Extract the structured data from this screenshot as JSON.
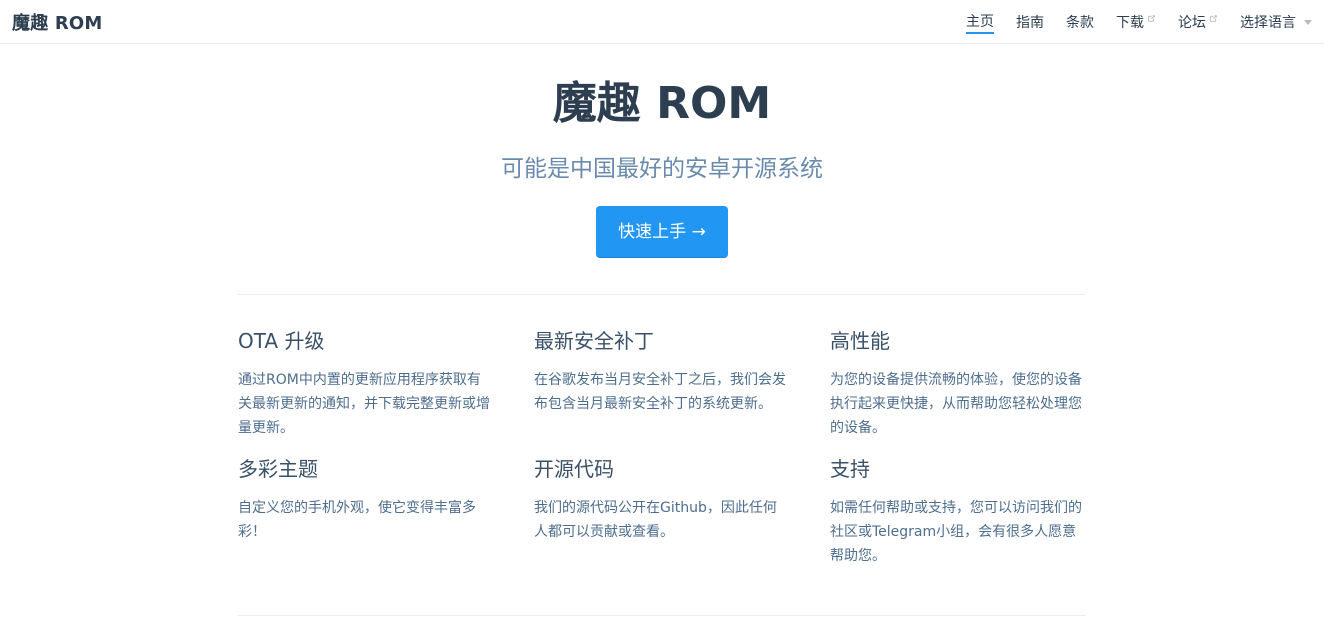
{
  "navbar": {
    "site_name": "魔趣 ROM",
    "links": [
      {
        "label": "主页",
        "active": true,
        "external": false
      },
      {
        "label": "指南",
        "active": false,
        "external": false
      },
      {
        "label": "条款",
        "active": false,
        "external": false
      },
      {
        "label": "下载",
        "active": false,
        "external": true
      },
      {
        "label": "论坛",
        "active": false,
        "external": true
      }
    ],
    "language_label": "选择语言",
    "accent_color": "#2196f3"
  },
  "hero": {
    "title": "魔趣 ROM",
    "description": "可能是中国最好的安卓开源系统",
    "action_label": "快速上手 →",
    "action_color": "#2196f3"
  },
  "features": [
    {
      "title": "OTA 升级",
      "details": "通过ROM中内置的更新应用程序获取有关最新更新的通知，并下载完整更新或增量更新。"
    },
    {
      "title": "最新安全补丁",
      "details": "在谷歌发布当月安全补丁之后，我们会发布包含当月最新安全补丁的系统更新。"
    },
    {
      "title": "高性能",
      "details": "为您的设备提供流畅的体验，使您的设备执行起来更快捷，从而帮助您轻松处理您的设备。"
    },
    {
      "title": "多彩主题",
      "details": "自定义您的手机外观，使它变得丰富多彩！"
    },
    {
      "title": "开源代码",
      "details": "我们的源代码公开在Github，因此任何人都可以贡献或查看。"
    },
    {
      "title": "支持",
      "details": "如需任何帮助或支持，您可以访问我们的社区或Telegram小组，会有很多人愿意帮助您。"
    }
  ]
}
